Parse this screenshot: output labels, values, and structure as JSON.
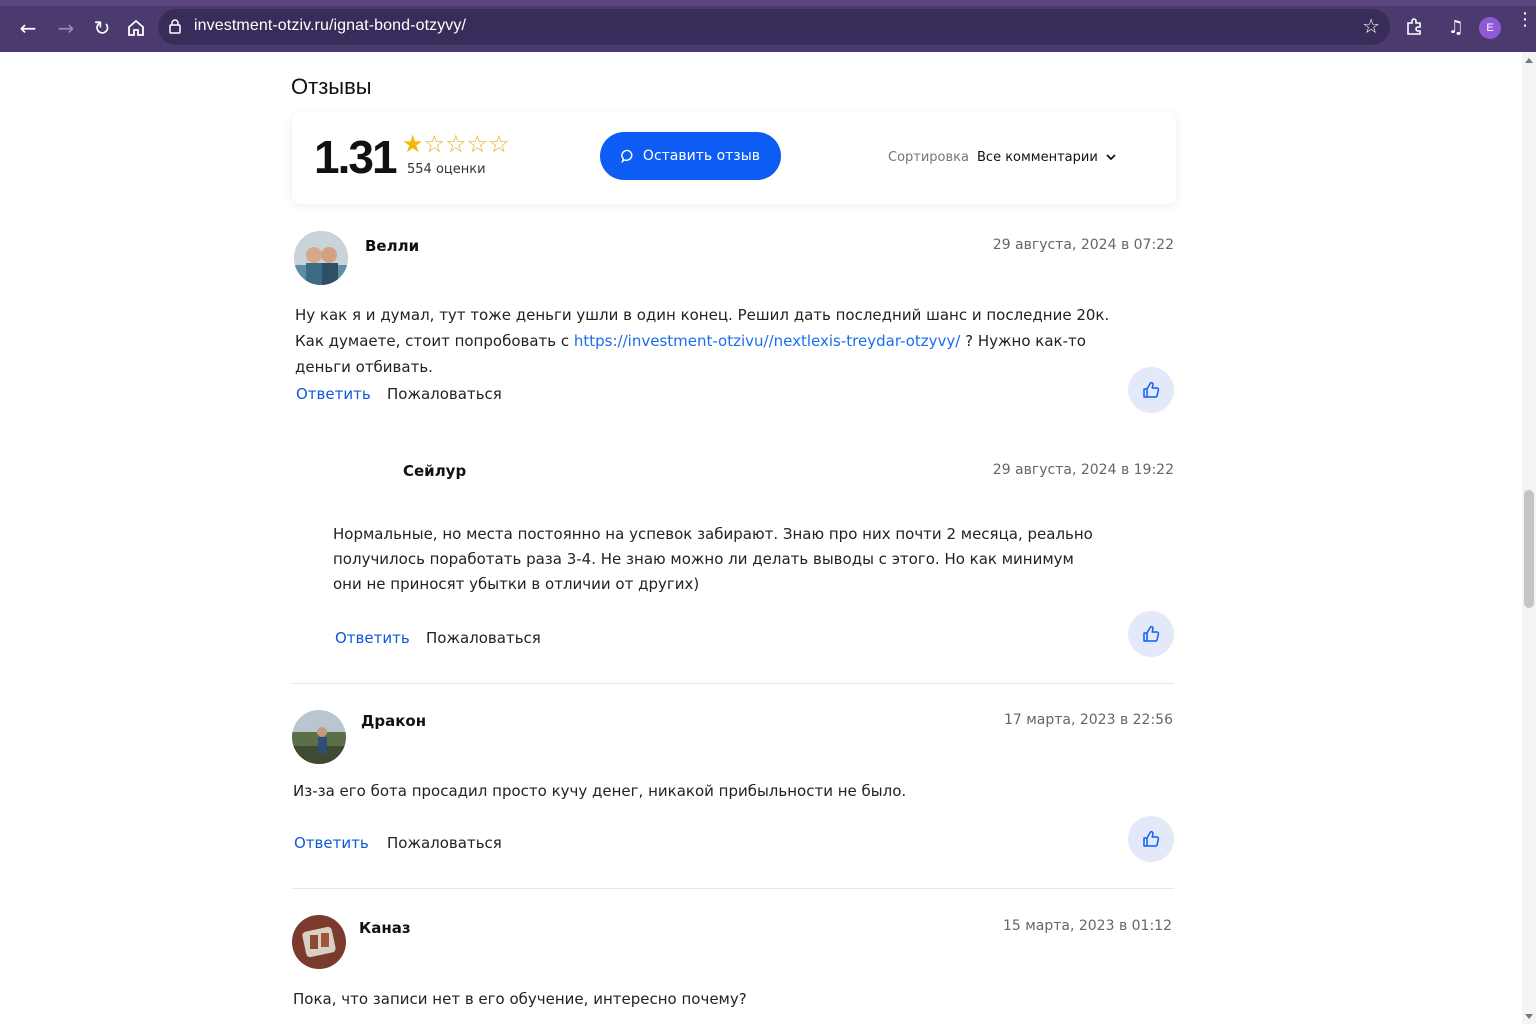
{
  "browser": {
    "url": "investment-otziv.ru/ignat-bond-otzyvy/",
    "profile_initial": "E"
  },
  "reviews": {
    "title": "Отзывы",
    "rating": "1.31",
    "stars_filled": 1,
    "stars_total": 5,
    "count_label": "554 оценки",
    "leave_button": "Оставить отзыв",
    "sort_label": "Сортировка",
    "sort_value": "Все комментарии"
  },
  "comments": [
    {
      "author": "Велли",
      "date": "29 августа, 2024 в 07:22",
      "text_before": "Ну как я и думал, тут тоже деньги ушли в один конец. Решил дать последний шанс и последние 20к. Как думаете, стоит попробовать с ",
      "link": "https://investment-otzivu//nextlexis-treydar-otzyvy/",
      "text_after": " ? Нужно как-то деньги отбивать.",
      "reply": "Ответить",
      "complain": "Пожаловаться"
    },
    {
      "author": "Сейлур",
      "date": "29 августа, 2024 в 19:22",
      "text": "Нормальные, но места постоянно на успевок забирают. Знаю про них почти 2 месяца, реально получилось поработать раза 3-4. Не знаю можно ли делать выводы с этого. Но как минимум они не приносят убытки в отличии от других)",
      "reply": "Ответить",
      "complain": "Пожаловаться"
    },
    {
      "author": "Дракон",
      "date": "17 марта, 2023 в 22:56",
      "text": "Из-за его бота просадил просто кучу денег, никакой прибыльности не было.",
      "reply": "Ответить",
      "complain": "Пожаловаться"
    },
    {
      "author": "Каназ",
      "date": "15 марта, 2023 в 01:12",
      "text": "Пока, что записи нет в его обучение, интересно почему?"
    }
  ],
  "colors": {
    "chrome": "#4a3a6e",
    "accent": "#0d5df5",
    "link": "#1a6cf0",
    "like_bg": "#e4e9fa",
    "star": "#f2b707"
  }
}
